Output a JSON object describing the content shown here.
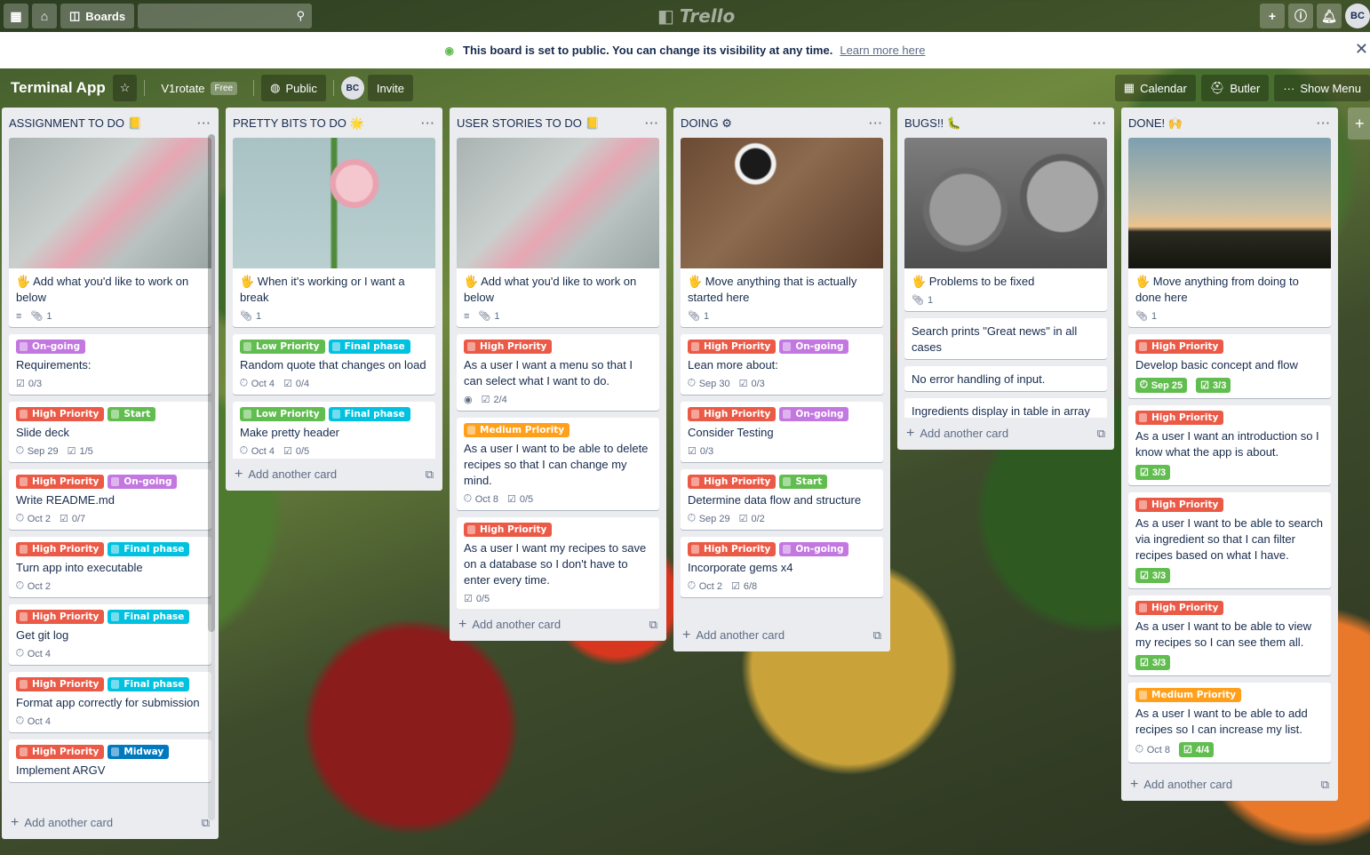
{
  "header": {
    "boards_label": "Boards",
    "logo_text": "Trello",
    "avatar_initials": "BC"
  },
  "banner": {
    "message": "This board is set to public. You can change its visibility at any time.",
    "link": "Learn more here"
  },
  "board": {
    "title": "Terminal App",
    "team": "V1rotate",
    "team_tag": "Free",
    "visibility": "Public",
    "member_initials": "BC",
    "invite": "Invite",
    "calendar": "Calendar",
    "butler": "Butler",
    "show_menu": "Show Menu"
  },
  "add_card_label": "Add another card",
  "lists": [
    {
      "title": "ASSIGNMENT TO DO",
      "title_emoji": "📒",
      "cards": [
        {
          "cover": "notes",
          "title": "Add what you'd like to work on below",
          "badges": {
            "desc": true,
            "attach": "1"
          }
        },
        {
          "labels": [
            {
              "text": "On-going",
              "color": "purple"
            }
          ],
          "title": "Requirements:",
          "badges": {
            "check": "0/3"
          }
        },
        {
          "labels": [
            {
              "text": "High Priority",
              "color": "red"
            },
            {
              "text": "Start",
              "color": "green"
            }
          ],
          "title": "Slide deck",
          "badges": {
            "due": "Sep 29",
            "check": "1/5"
          }
        },
        {
          "labels": [
            {
              "text": "High Priority",
              "color": "red"
            },
            {
              "text": "On-going",
              "color": "purple"
            }
          ],
          "title": "Write README.md",
          "badges": {
            "due": "Oct 2",
            "check": "0/7"
          }
        },
        {
          "labels": [
            {
              "text": "High Priority",
              "color": "red"
            },
            {
              "text": "Final phase",
              "color": "sky"
            }
          ],
          "title": "Turn app into executable",
          "badges": {
            "due": "Oct 2"
          }
        },
        {
          "labels": [
            {
              "text": "High Priority",
              "color": "red"
            },
            {
              "text": "Final phase",
              "color": "sky"
            }
          ],
          "title": "Get git log",
          "badges": {
            "due": "Oct 4"
          }
        },
        {
          "labels": [
            {
              "text": "High Priority",
              "color": "red"
            },
            {
              "text": "Final phase",
              "color": "sky"
            }
          ],
          "title": "Format app correctly for submission",
          "badges": {
            "due": "Oct 4"
          }
        },
        {
          "labels": [
            {
              "text": "High Priority",
              "color": "red"
            },
            {
              "text": "Midway",
              "color": "blue"
            }
          ],
          "title": "Implement ARGV",
          "badges": {}
        }
      ]
    },
    {
      "title": "PRETTY BITS TO DO",
      "title_emoji": "🌟",
      "cards": [
        {
          "cover": "flower",
          "title": "When it's working or I want a break",
          "badges": {
            "attach": "1"
          }
        },
        {
          "labels": [
            {
              "text": "Low Priority",
              "color": "green"
            },
            {
              "text": "Final phase",
              "color": "sky"
            }
          ],
          "title": "Random quote that changes on load",
          "badges": {
            "due": "Oct 4",
            "check": "0/4"
          }
        },
        {
          "labels": [
            {
              "text": "Low Priority",
              "color": "green"
            },
            {
              "text": "Final phase",
              "color": "sky"
            }
          ],
          "title": "Make pretty header",
          "badges": {
            "due": "Oct 4",
            "check": "0/5"
          }
        }
      ]
    },
    {
      "title": "USER STORIES TO DO",
      "title_emoji": "📒",
      "cards": [
        {
          "cover": "notes",
          "title": "Add what you'd like to work on below",
          "badges": {
            "desc": true,
            "attach": "1"
          }
        },
        {
          "labels": [
            {
              "text": "High Priority",
              "color": "red"
            }
          ],
          "title": "As a user I want a menu so that I can select what I want to do.",
          "badges": {
            "watch": true,
            "check": "2/4"
          }
        },
        {
          "labels": [
            {
              "text": "Medium Priority",
              "color": "orange"
            }
          ],
          "title": "As a user I want to be able to delete recipes so that I can change my mind.",
          "badges": {
            "due": "Oct 8",
            "check": "0/5"
          }
        },
        {
          "labels": [
            {
              "text": "High Priority",
              "color": "red"
            }
          ],
          "title": "As a user I want my recipes to save on a database so I don't have to enter every time.",
          "badges": {
            "check": "0/5"
          }
        }
      ]
    },
    {
      "title": "DOING",
      "title_emoji": "⚙",
      "cards": [
        {
          "cover": "desk",
          "title": "Move anything that is actually started here",
          "badges": {
            "attach": "1"
          }
        },
        {
          "labels": [
            {
              "text": "High Priority",
              "color": "red"
            },
            {
              "text": "On-going",
              "color": "purple"
            }
          ],
          "title": "Lean more about:",
          "badges": {
            "due": "Sep 30",
            "check": "0/3"
          }
        },
        {
          "labels": [
            {
              "text": "High Priority",
              "color": "red"
            },
            {
              "text": "On-going",
              "color": "purple"
            }
          ],
          "title": "Consider Testing",
          "badges": {
            "check": "0/3"
          }
        },
        {
          "labels": [
            {
              "text": "High Priority",
              "color": "red"
            },
            {
              "text": "Start",
              "color": "green"
            }
          ],
          "title": "Determine data flow and structure",
          "badges": {
            "due": "Sep 29",
            "check": "0/2"
          }
        },
        {
          "labels": [
            {
              "text": "High Priority",
              "color": "red"
            },
            {
              "text": "On-going",
              "color": "purple"
            }
          ],
          "title": "Incorporate gems x4",
          "badges": {
            "due": "Oct 2",
            "check": "6/8"
          }
        }
      ]
    },
    {
      "title": "BUGS!!",
      "title_emoji": "🐛",
      "cards": [
        {
          "cover": "gears",
          "title": "Problems to be fixed",
          "badges": {
            "attach": "1"
          }
        },
        {
          "title": "Search prints \"Great news\" in all cases",
          "badges": {}
        },
        {
          "title": "No error handling of input.",
          "badges": {}
        },
        {
          "title": "Ingredients display in table in array",
          "badges": {}
        }
      ]
    },
    {
      "title": "DONE!",
      "title_emoji": "🙌",
      "cards": [
        {
          "cover": "sunset",
          "title": "Move anything from doing to done here",
          "badges": {
            "attach": "1"
          }
        },
        {
          "labels": [
            {
              "text": "High Priority",
              "color": "red"
            }
          ],
          "title": "Develop basic concept and flow",
          "badges": {
            "due_done": "Sep 25",
            "check_done": "3/3"
          }
        },
        {
          "labels": [
            {
              "text": "High Priority",
              "color": "red"
            }
          ],
          "title": "As a user I want an introduction so I know what the app is about.",
          "badges": {
            "check_done": "3/3"
          }
        },
        {
          "labels": [
            {
              "text": "High Priority",
              "color": "red"
            }
          ],
          "title": "As a user I want to be able to search via ingredient so that I can filter recipes based on what I have.",
          "badges": {
            "check_done": "3/3"
          }
        },
        {
          "labels": [
            {
              "text": "High Priority",
              "color": "red"
            }
          ],
          "title": "As a user I want to be able to view my recipes so I can see them all.",
          "badges": {
            "check_done": "3/3"
          }
        },
        {
          "labels": [
            {
              "text": "Medium Priority",
              "color": "orange"
            }
          ],
          "title": "As a user I want to be able to add recipes so I can increase my list.",
          "badges": {
            "due": "Oct 8",
            "check_done": "4/4"
          }
        }
      ]
    }
  ]
}
